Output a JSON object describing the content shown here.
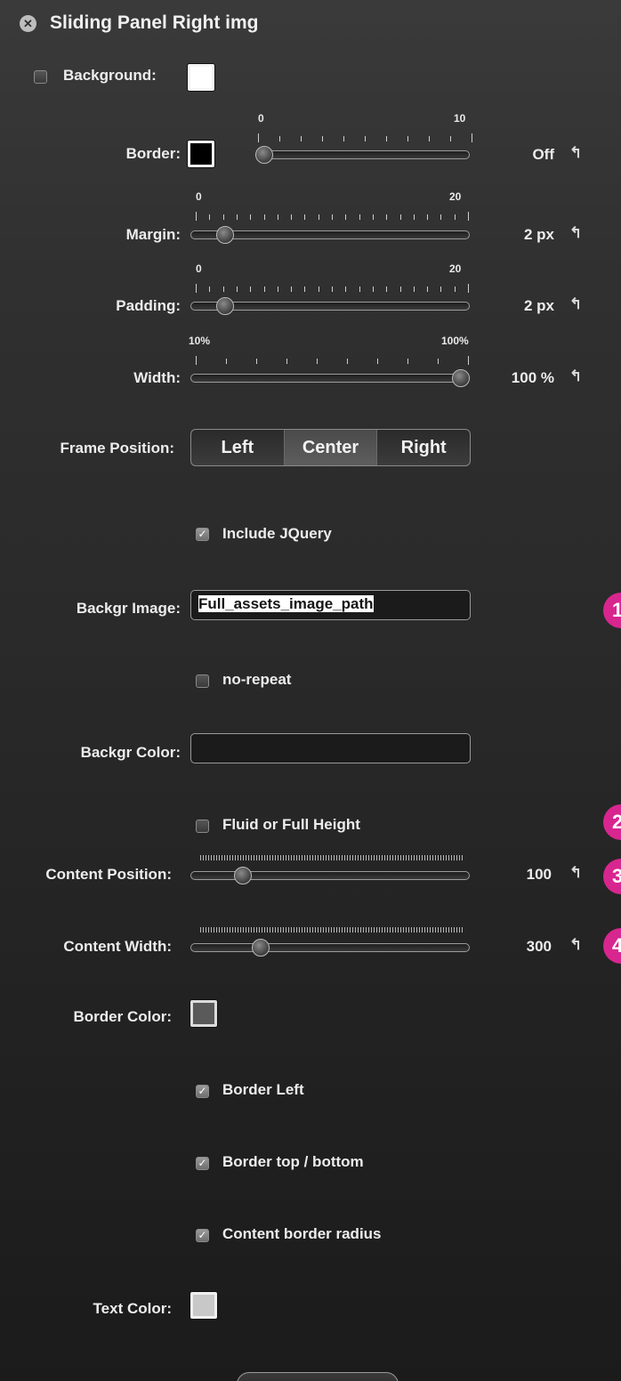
{
  "panel": {
    "title": "Sliding Panel Right img"
  },
  "background": {
    "label": "Background:",
    "checked": false
  },
  "border": {
    "label": "Border:",
    "min": "0",
    "max": "10",
    "value": "Off",
    "level": 0
  },
  "margin": {
    "label": "Margin:",
    "min": "0",
    "max": "20",
    "value": "2 px",
    "level": 0.1
  },
  "padding": {
    "label": "Padding:",
    "min": "0",
    "max": "20",
    "value": "2 px",
    "level": 0.1
  },
  "width": {
    "label": "Width:",
    "min": "10%",
    "max": "100%",
    "value": "100 %",
    "level": 1.0
  },
  "frame_position": {
    "label": "Frame Position:",
    "options": [
      "Left",
      "Center",
      "Right"
    ],
    "selected": "Center"
  },
  "include_jquery": {
    "label": "Include JQuery",
    "checked": true
  },
  "backgr_image": {
    "label": "Backgr Image:",
    "value": "Full_assets_image_path"
  },
  "no_repeat": {
    "label": "no-repeat",
    "checked": false
  },
  "backgr_color": {
    "label": "Backgr Color:",
    "value": ""
  },
  "fluid_height": {
    "label": "Fluid or Full Height",
    "checked": false
  },
  "content_position": {
    "label": "Content Position:",
    "value": "100"
  },
  "content_width": {
    "label": "Content Width:",
    "value": "300"
  },
  "border_color": {
    "label": "Border Color:",
    "swatch": "#5a5a5a"
  },
  "border_left": {
    "label": "Border Left",
    "checked": true
  },
  "border_top_bottom": {
    "label": "Border top / bottom",
    "checked": true
  },
  "content_border_radius": {
    "label": "Content border radius",
    "checked": true
  },
  "text_color": {
    "label": "Text Color:",
    "swatch": "#c8c8c8"
  },
  "undo_glyph": "↰",
  "check_glyph": "✓",
  "close_glyph": "✕",
  "badges": [
    "1",
    "2",
    "3",
    "4"
  ],
  "colors": {
    "badge": "#d8268f",
    "accent_text": "#ededed"
  }
}
